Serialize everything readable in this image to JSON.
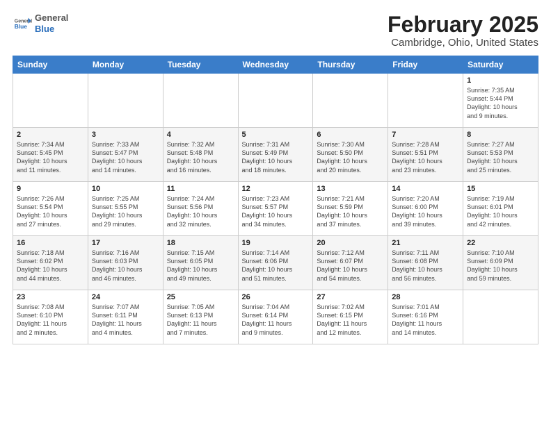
{
  "header": {
    "logo_general": "General",
    "logo_blue": "Blue",
    "title": "February 2025",
    "subtitle": "Cambridge, Ohio, United States"
  },
  "days_of_week": [
    "Sunday",
    "Monday",
    "Tuesday",
    "Wednesday",
    "Thursday",
    "Friday",
    "Saturday"
  ],
  "weeks": [
    [
      {
        "day": "",
        "info": ""
      },
      {
        "day": "",
        "info": ""
      },
      {
        "day": "",
        "info": ""
      },
      {
        "day": "",
        "info": ""
      },
      {
        "day": "",
        "info": ""
      },
      {
        "day": "",
        "info": ""
      },
      {
        "day": "1",
        "info": "Sunrise: 7:35 AM\nSunset: 5:44 PM\nDaylight: 10 hours\nand 9 minutes."
      }
    ],
    [
      {
        "day": "2",
        "info": "Sunrise: 7:34 AM\nSunset: 5:45 PM\nDaylight: 10 hours\nand 11 minutes."
      },
      {
        "day": "3",
        "info": "Sunrise: 7:33 AM\nSunset: 5:47 PM\nDaylight: 10 hours\nand 14 minutes."
      },
      {
        "day": "4",
        "info": "Sunrise: 7:32 AM\nSunset: 5:48 PM\nDaylight: 10 hours\nand 16 minutes."
      },
      {
        "day": "5",
        "info": "Sunrise: 7:31 AM\nSunset: 5:49 PM\nDaylight: 10 hours\nand 18 minutes."
      },
      {
        "day": "6",
        "info": "Sunrise: 7:30 AM\nSunset: 5:50 PM\nDaylight: 10 hours\nand 20 minutes."
      },
      {
        "day": "7",
        "info": "Sunrise: 7:28 AM\nSunset: 5:51 PM\nDaylight: 10 hours\nand 23 minutes."
      },
      {
        "day": "8",
        "info": "Sunrise: 7:27 AM\nSunset: 5:53 PM\nDaylight: 10 hours\nand 25 minutes."
      }
    ],
    [
      {
        "day": "9",
        "info": "Sunrise: 7:26 AM\nSunset: 5:54 PM\nDaylight: 10 hours\nand 27 minutes."
      },
      {
        "day": "10",
        "info": "Sunrise: 7:25 AM\nSunset: 5:55 PM\nDaylight: 10 hours\nand 29 minutes."
      },
      {
        "day": "11",
        "info": "Sunrise: 7:24 AM\nSunset: 5:56 PM\nDaylight: 10 hours\nand 32 minutes."
      },
      {
        "day": "12",
        "info": "Sunrise: 7:23 AM\nSunset: 5:57 PM\nDaylight: 10 hours\nand 34 minutes."
      },
      {
        "day": "13",
        "info": "Sunrise: 7:21 AM\nSunset: 5:59 PM\nDaylight: 10 hours\nand 37 minutes."
      },
      {
        "day": "14",
        "info": "Sunrise: 7:20 AM\nSunset: 6:00 PM\nDaylight: 10 hours\nand 39 minutes."
      },
      {
        "day": "15",
        "info": "Sunrise: 7:19 AM\nSunset: 6:01 PM\nDaylight: 10 hours\nand 42 minutes."
      }
    ],
    [
      {
        "day": "16",
        "info": "Sunrise: 7:18 AM\nSunset: 6:02 PM\nDaylight: 10 hours\nand 44 minutes."
      },
      {
        "day": "17",
        "info": "Sunrise: 7:16 AM\nSunset: 6:03 PM\nDaylight: 10 hours\nand 46 minutes."
      },
      {
        "day": "18",
        "info": "Sunrise: 7:15 AM\nSunset: 6:05 PM\nDaylight: 10 hours\nand 49 minutes."
      },
      {
        "day": "19",
        "info": "Sunrise: 7:14 AM\nSunset: 6:06 PM\nDaylight: 10 hours\nand 51 minutes."
      },
      {
        "day": "20",
        "info": "Sunrise: 7:12 AM\nSunset: 6:07 PM\nDaylight: 10 hours\nand 54 minutes."
      },
      {
        "day": "21",
        "info": "Sunrise: 7:11 AM\nSunset: 6:08 PM\nDaylight: 10 hours\nand 56 minutes."
      },
      {
        "day": "22",
        "info": "Sunrise: 7:10 AM\nSunset: 6:09 PM\nDaylight: 10 hours\nand 59 minutes."
      }
    ],
    [
      {
        "day": "23",
        "info": "Sunrise: 7:08 AM\nSunset: 6:10 PM\nDaylight: 11 hours\nand 2 minutes."
      },
      {
        "day": "24",
        "info": "Sunrise: 7:07 AM\nSunset: 6:11 PM\nDaylight: 11 hours\nand 4 minutes."
      },
      {
        "day": "25",
        "info": "Sunrise: 7:05 AM\nSunset: 6:13 PM\nDaylight: 11 hours\nand 7 minutes."
      },
      {
        "day": "26",
        "info": "Sunrise: 7:04 AM\nSunset: 6:14 PM\nDaylight: 11 hours\nand 9 minutes."
      },
      {
        "day": "27",
        "info": "Sunrise: 7:02 AM\nSunset: 6:15 PM\nDaylight: 11 hours\nand 12 minutes."
      },
      {
        "day": "28",
        "info": "Sunrise: 7:01 AM\nSunset: 6:16 PM\nDaylight: 11 hours\nand 14 minutes."
      },
      {
        "day": "",
        "info": ""
      }
    ]
  ]
}
